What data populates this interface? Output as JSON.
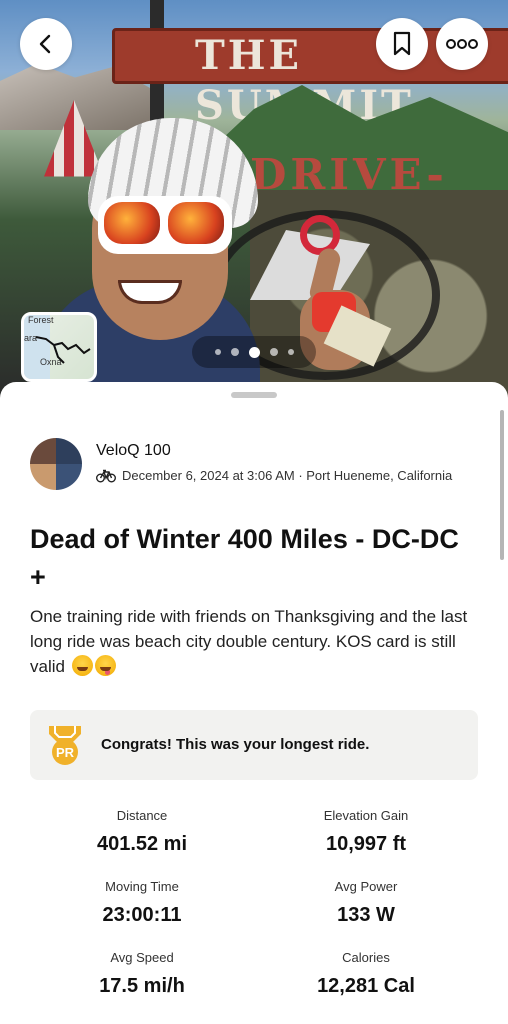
{
  "hero": {
    "sign_text": "THE SUMMIT",
    "sign2_text": "DRIVE-IN",
    "carousel": {
      "count": 5,
      "active_index": 2
    },
    "map_labels": [
      "Forest",
      "ara",
      "Oxna"
    ]
  },
  "nav": {
    "back_icon": "chevron-left-icon",
    "bookmark_icon": "bookmark-icon",
    "more_icon": "more-horizontal-icon"
  },
  "activity": {
    "athlete_name": "VeloQ 100",
    "sport_icon": "bike-icon",
    "date_location": "December 6, 2024 at 3:06 AM · Port Hueneme, California",
    "title": "Dead of Winter 400 Miles - DC-DC +",
    "description": "One training ride with friends on Thanksgiving and the last long ride was beach city double century. KOS card is still valid",
    "description_emojis": [
      "grinning-sweat-emoji",
      "winking-tongue-emoji"
    ]
  },
  "achievement": {
    "badge_icon": "pr-medal-icon",
    "badge_text": "PR",
    "text": "Congrats! This was your longest ride.",
    "color": "#e8a21c"
  },
  "stats": [
    {
      "label": "Distance",
      "value": "401.52 mi"
    },
    {
      "label": "Elevation Gain",
      "value": "10,997 ft"
    },
    {
      "label": "Moving Time",
      "value": "23:00:11"
    },
    {
      "label": "Avg Power",
      "value": "133 W"
    },
    {
      "label": "Avg Speed",
      "value": "17.5 mi/h"
    },
    {
      "label": "Calories",
      "value": "12,281 Cal"
    }
  ]
}
